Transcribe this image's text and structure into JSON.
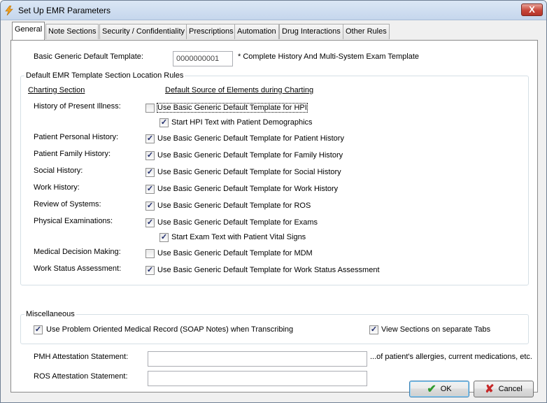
{
  "window": {
    "title": "Set Up EMR Parameters",
    "close_label": "X"
  },
  "tabs": [
    {
      "label": "General",
      "active": true
    },
    {
      "label": "Note Sections"
    },
    {
      "label": "Security / Confidentiality"
    },
    {
      "label": "Prescriptions"
    },
    {
      "label": "Automation"
    },
    {
      "label": "Drug Interactions"
    },
    {
      "label": "Other Rules"
    }
  ],
  "general": {
    "template_label": "Basic Generic Default Template:",
    "template_value": "0000000001",
    "template_desc": "* Complete History And Multi-System Exam Template",
    "rules_group_title": "Default EMR Template Section Location Rules",
    "col_section": "Charting Section",
    "col_source": "Default Source of Elements during Charting",
    "rows": [
      {
        "section": "History of Present Illness:",
        "option": "Use Basic Generic Default Template for HPI",
        "checked": false
      },
      {
        "section": "",
        "option": "Start HPI Text with Patient Demographics",
        "checked": true
      },
      {
        "section": "Patient Personal History:",
        "option": "Use Basic Generic Default Template for Patient History",
        "checked": true
      },
      {
        "section": "Patient Family History:",
        "option": "Use Basic Generic Default Template for Family History",
        "checked": true
      },
      {
        "section": "Social History:",
        "option": "Use Basic Generic Default Template for Social History",
        "checked": true
      },
      {
        "section": "Work History:",
        "option": "Use Basic Generic Default Template for Work History",
        "checked": true
      },
      {
        "section": "Review of Systems:",
        "option": "Use Basic Generic Default Template for ROS",
        "checked": true
      },
      {
        "section": "Physical Examinations:",
        "option": "Use Basic Generic Default Template for Exams",
        "checked": true
      },
      {
        "section": "",
        "option": "Start Exam Text with Patient Vital Signs",
        "checked": true
      },
      {
        "section": "Medical Decision Making:",
        "option": "Use Basic Generic Default Template for MDM",
        "checked": false
      },
      {
        "section": "Work Status Assessment:",
        "option": "Use Basic Generic Default Template for Work Status Assessment",
        "checked": true
      }
    ],
    "misc_group_title": "Miscellaneous",
    "misc_soap": {
      "label": "Use Problem Oriented Medical Record (SOAP Notes) when Transcribing",
      "checked": true
    },
    "misc_tabs": {
      "label": "View Sections on separate Tabs",
      "checked": true
    },
    "pmh_label": "PMH Attestation Statement:",
    "pmh_value": "",
    "pmh_suffix": "...of patient's allergies, current medications, etc.",
    "ros_label": "ROS Attestation Statement:",
    "ros_value": ""
  },
  "buttons": {
    "ok": "OK",
    "cancel": "Cancel",
    "ok_icon": "✔",
    "cancel_icon": "✘"
  },
  "colors": {
    "ok_icon": "#2f9a2f",
    "cancel_icon": "#c62828",
    "check": "#1d2a6b"
  }
}
